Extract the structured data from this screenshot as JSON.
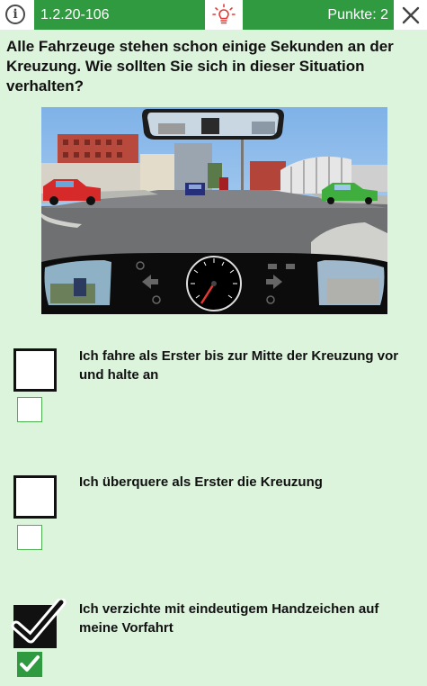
{
  "header": {
    "question_id": "1.2.20-106",
    "points": "Punkte: 2",
    "info_symbol": "i",
    "icons": [
      "info-icon",
      "lightbulb-icon",
      "close-icon"
    ],
    "accent_color": "#2f9a3f",
    "hint_color": "#e53935"
  },
  "question": {
    "text": "Alle Fahrzeuge stehen schon einige Sekunden an der Kreuzung. Wie sollten Sie sich in dieser Situation verhalten?"
  },
  "answers": [
    {
      "text": "Ich fahre als Erster bis zur Mitte der Kreuzung vor und halte an",
      "selected": false,
      "correct": false
    },
    {
      "text": "Ich überquere als Erster die Kreuzung",
      "selected": false,
      "correct": false
    },
    {
      "text": "Ich verzichte mit eindeutigem Handzeichen auf meine Vorfahrt",
      "selected": true,
      "correct": true
    }
  ]
}
